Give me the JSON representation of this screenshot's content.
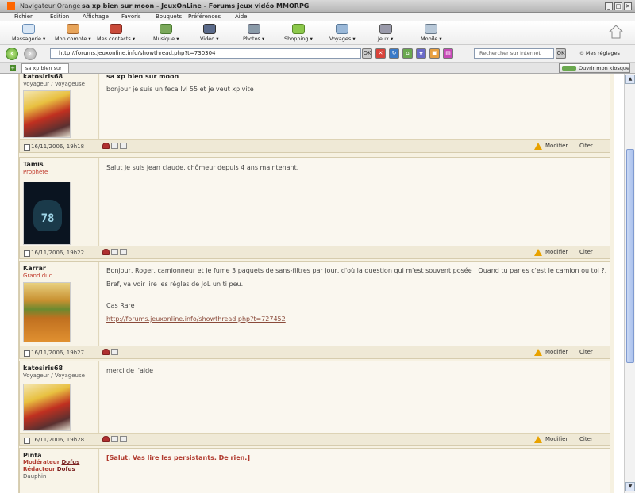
{
  "window": {
    "app_name": "Navigateur Orange",
    "title": "sa xp bien sur moon - JeuxOnLine - Forums jeux vidéo MMORPG"
  },
  "menu": [
    "Fichier",
    "Edition",
    "Affichage",
    "Favoris",
    "Bouquets",
    "Préférences",
    "Aide"
  ],
  "toolbar": {
    "items": [
      {
        "label": "Messagerie",
        "icon": "envelope-icon"
      },
      {
        "label": "Mon compte",
        "icon": "user-account-icon"
      },
      {
        "label": "Mes contacts",
        "icon": "contacts-icon"
      },
      {
        "label": "Musique",
        "icon": "music-icon"
      },
      {
        "label": "Vidéo",
        "icon": "video-icon"
      },
      {
        "label": "Photos",
        "icon": "camera-icon"
      },
      {
        "label": "Shopping",
        "icon": "shopping-bag-icon"
      },
      {
        "label": "Voyages",
        "icon": "plane-icon"
      },
      {
        "label": "Jeux",
        "icon": "joystick-icon"
      },
      {
        "label": "Mobile",
        "icon": "phone-icon"
      }
    ]
  },
  "nav": {
    "url": "http://forums.jeuxonline.info/showthread.php?t=730304",
    "search_placeholder": "Rechercher sur Internet",
    "ok": "OK",
    "settings": "Mes réglages"
  },
  "tabs": {
    "active": "sa xp bien sur ...",
    "kiosque": "Ouvrir mon kiosque"
  },
  "actions": {
    "edit": "Modifier",
    "quote": "Citer"
  },
  "posts": [
    {
      "user": "katosiris68",
      "rank": "Voyageur / Voyageuse",
      "title": "sa xp bien sur moon",
      "lines": [
        "bonjour je suis un feca lvl 55 et je veut xp vite"
      ],
      "date": "16/11/2006, 19h18",
      "avatar": "alchemist-avatar"
    },
    {
      "user": "Tamis",
      "rank": "Prophète",
      "lines": [
        "Salut je suis jean claude, chômeur depuis 4 ans maintenant."
      ],
      "date": "16/11/2006, 19h22",
      "avatar": "number-78-avatar"
    },
    {
      "user": "Karrar",
      "rank": "Grand duc",
      "lines": [
        "Bonjour, Roger, camionneur et je fume 3 paquets de sans-filtres par jour, d'où la question qui m'est souvent posée : Quand tu parles c'est le camion ou toi ?.",
        "Bref, va voir lire les règles de JoL un ti peu.",
        "Cas Rare"
      ],
      "link": "http://forums.jeuxonline.info/showthread.php?t=727452",
      "date": "16/11/2006, 19h27",
      "avatar": "burger-avatar"
    },
    {
      "user": "katosiris68",
      "rank": "Voyageur / Voyageuse",
      "lines": [
        "merci de l'aide"
      ],
      "date": "16/11/2006, 19h28",
      "avatar": "alchemist-avatar"
    },
    {
      "user": "Pinta",
      "rank_parts": [
        "Modérateur",
        "Dofus",
        "Rédacteur",
        "Dofus",
        "Dauphin"
      ],
      "lines": [
        "[Salut. Vas lire les persistants. De rien.]"
      ]
    }
  ]
}
